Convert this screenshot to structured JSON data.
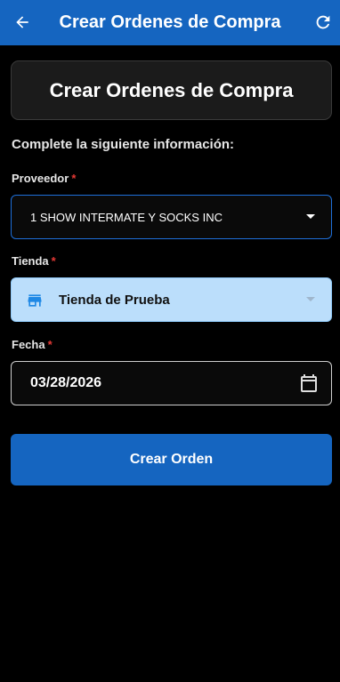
{
  "appbar": {
    "title": "Crear Ordenes de Compra",
    "back_icon": "arrow-left-icon",
    "refresh_icon": "refresh-icon",
    "color": "#1565c0"
  },
  "header": {
    "title": "Crear Ordenes de Compra"
  },
  "form": {
    "instructions": "Complete la siguiente información:",
    "required_mark": "*",
    "proveedor": {
      "label": "Proveedor",
      "value": "1 SHOW INTERMATE Y SOCKS INC"
    },
    "tienda": {
      "label": "Tienda",
      "value": "Tienda de Prueba",
      "icon": "store-icon"
    },
    "fecha": {
      "label": "Fecha",
      "value": "03/28/2026",
      "icon": "calendar-icon"
    },
    "submit_label": "Crear Orden"
  }
}
